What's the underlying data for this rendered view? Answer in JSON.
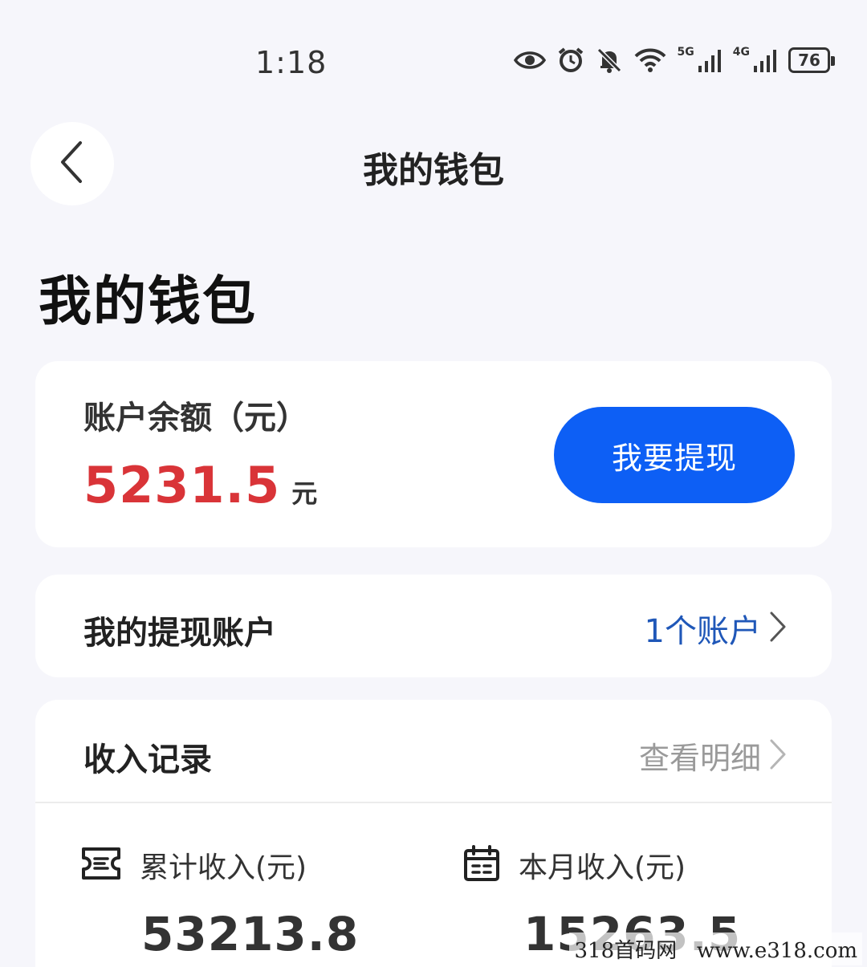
{
  "status_bar": {
    "time": "1:18",
    "network_5g": "5G",
    "network_4g": "4G",
    "battery": "76",
    "icons": [
      "eye-icon",
      "alarm-icon",
      "bell-muted-icon",
      "wifi-icon",
      "signal-icon",
      "signal-icon",
      "battery-icon"
    ]
  },
  "nav": {
    "back_icon": "chevron-left-icon",
    "title": "我的钱包"
  },
  "page": {
    "title": "我的钱包"
  },
  "balance": {
    "label": "账户余额（元）",
    "value": "5231.5",
    "unit": "元",
    "withdraw_label": "我要提现",
    "value_color": "#d93438",
    "button_color": "#0d5ff5"
  },
  "withdraw_account": {
    "title": "我的提现账户",
    "count": "1个账户",
    "count_color": "#1f57b8"
  },
  "income": {
    "title": "收入记录",
    "detail_label": "查看明细",
    "total": {
      "icon": "ticket-icon",
      "label": "累计收入(元)",
      "value": "53213.8"
    },
    "month": {
      "icon": "calendar-icon",
      "label": "本月收入(元)",
      "value": "15263.5"
    }
  },
  "watermark": "318首码网   www.e318.com"
}
